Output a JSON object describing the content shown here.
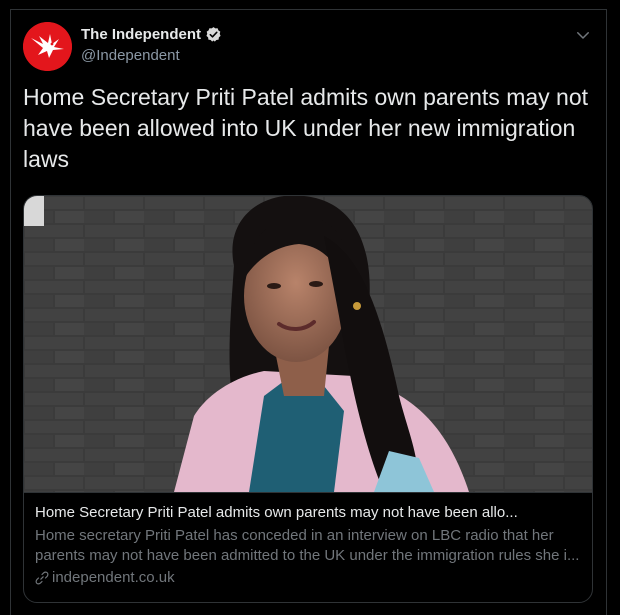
{
  "author": {
    "display_name": "The Independent",
    "handle": "@Independent",
    "verified": true,
    "avatar_icon": "eagle-logo-icon",
    "avatar_color": "#e3161c"
  },
  "menu_icon": "chevron-down-icon",
  "tweet": {
    "text": "Home Secretary Priti Patel admits own parents may not have been allowed into UK under her new immigration laws"
  },
  "card": {
    "image_alt": "Priti Patel photo",
    "title": "Home Secretary Priti Patel admits own parents may not have been allo...",
    "description_line1": "Home secretary Priti Patel has conceded in an interview on LBC radio that her",
    "description_line2": "parents may not have been admitted to the UK under the immigration rules she i...",
    "domain": "independent.co.uk",
    "domain_icon": "link-icon"
  },
  "colors": {
    "background": "#000000",
    "primary_text": "#e7e9ea",
    "secondary_text": "#71767b",
    "border": "#2f3336",
    "verified_badge": "#d9d9d9"
  }
}
